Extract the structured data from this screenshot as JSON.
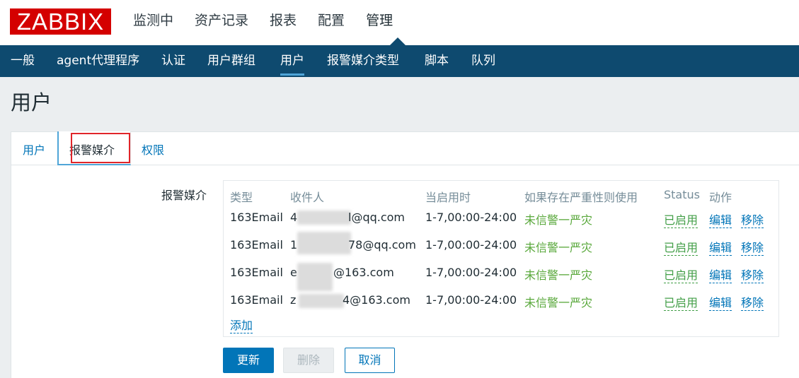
{
  "logo": "ZABBIX",
  "main_nav": [
    "监测中",
    "资产记录",
    "报表",
    "配置",
    "管理"
  ],
  "sub_nav": [
    "一般",
    "agent代理程序",
    "认证",
    "用户群组",
    "用户",
    "报警媒介类型",
    "脚本",
    "队列"
  ],
  "page_title": "用户",
  "tabs": {
    "user": "用户",
    "media": "报警媒介",
    "permissions": "权限"
  },
  "media": {
    "label": "报警媒介",
    "headers": {
      "type": "类型",
      "sendto": "收件人",
      "when": "当启用时",
      "severity": "如果存在严重性则使用",
      "status": "Status",
      "action": "动作"
    },
    "rows": [
      {
        "type": "163Email",
        "sendto_start": "4",
        "sendto_end": "l@qq.com",
        "when": "1-7,00:00-24:00",
        "severity": "未信警一严灾",
        "status": "已启用",
        "edit": "编辑",
        "remove": "移除"
      },
      {
        "type": "163Email",
        "sendto_start": "1",
        "sendto_end": "78@qq.com",
        "when": "1-7,00:00-24:00",
        "severity": "未信警一严灾",
        "status": "已启用",
        "edit": "编辑",
        "remove": "移除"
      },
      {
        "type": "163Email",
        "sendto_start": "e",
        "sendto_end": "@163.com",
        "when": "1-7,00:00-24:00",
        "severity": "未信警一严灾",
        "status": "已启用",
        "edit": "编辑",
        "remove": "移除"
      },
      {
        "type": "163Email",
        "sendto_start": "z",
        "sendto_end": "4@163.com",
        "when": "1-7,00:00-24:00",
        "severity": "未信警一严灾",
        "status": "已启用",
        "edit": "编辑",
        "remove": "移除"
      }
    ],
    "add": "添加"
  },
  "buttons": {
    "update": "更新",
    "delete": "删除",
    "cancel": "取消"
  }
}
